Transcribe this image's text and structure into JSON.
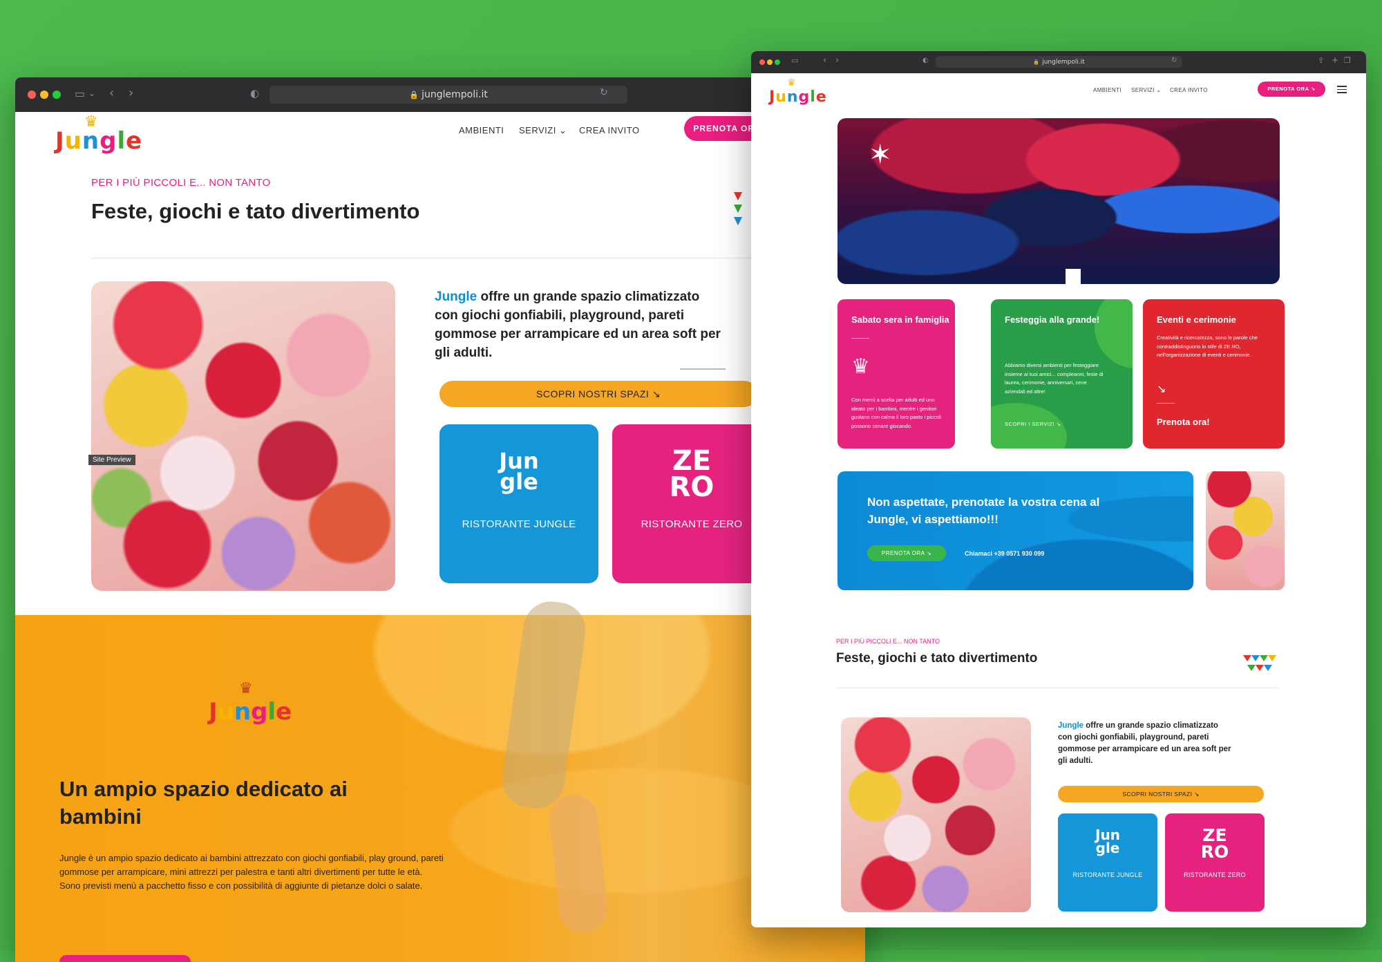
{
  "logo": {
    "letters": [
      "J",
      "u",
      "n",
      "g",
      "l",
      "e"
    ],
    "colors": [
      "#e63329",
      "#f4b400",
      "#1f8fd6",
      "#e91e7e",
      "#3aa935",
      "#e63329"
    ],
    "crown": "♛"
  },
  "left_window": {
    "url": "junglempoli.it",
    "nav": {
      "ambienti": "AMBIENTI",
      "servizi": "SERVIZI ⌄",
      "crea_invito": "CREA INVITO",
      "cta": "PRENOTA ORA ↘"
    },
    "kicker": "PER I PIÙ PICCOLI E... NON TANTO",
    "title": "Feste, giochi e tato divertimento",
    "site_preview": "Site Preview",
    "desc_brand": "Jungle",
    "desc_rest": " offre un grande spazio climatizzato con giochi gonfiabili, playground, pareti gommose per arrampicare ed un area soft per gli adulti.",
    "scopri": "SCOPRI NOSTRI SPAZI ↘",
    "tile_jungle": {
      "mark": "Jun\ngle",
      "label": "RISTORANTE JUNGLE"
    },
    "tile_zero": {
      "mark": "ZE\nRO",
      "label": "RISTORANTE ZERO"
    },
    "orange": {
      "title": "Un ampio spazio dedicato ai bambini",
      "text1": "Jungle è un ampio spazio dedicato ai bambini attrezzato con giochi gonfiabili, play ground, pareti gommose per arrampicare, mini attrezzi per palestra e tanti altri divertimenti per tutte le età.",
      "text2": "Sono previsti menù a pacchetto fisso e con possibilità di aggiunte di pietanze dolci o salate."
    }
  },
  "right_window": {
    "url": "junglempoli.it",
    "nav": {
      "ambienti": "AMBIENTI",
      "servizi": "SERVIZI ⌄",
      "crea_invito": "CREA INVITO",
      "cta": "PRENOTA ORA ↘"
    },
    "cards": [
      {
        "title": "Sabato sera in famiglia",
        "text": "Con menù a scelta per adulti ed uno ideato per i bambini, mentre i genitori gustano con calma il loro pasto i piccoli possono cenare giocando."
      },
      {
        "title": "Festeggia alla grande!",
        "text": "Abbiamo diversi ambienti per festeggiare insieme ai tuoi amici... compleanni, feste di laurea, cerimonie, anniversari, cene aziendali ed altre!",
        "button": "SCOPRI I SERVIZI ↘"
      },
      {
        "title": "Eventi e cerimonie",
        "text": "Creatività e ricercatezza, sono le parole che contraddistinguono lo stile di ZE.RO, nell'organizzazione di eventi e cerimonie.",
        "link": "Prenota ora!"
      }
    ],
    "banner": {
      "title": "Non aspettate, prenotate la vostra cena al Jungle, vi aspettiamo!!!",
      "button": "PRENOTA ORA ↘",
      "call": "Chiamaci +39 0571 930 099"
    },
    "kicker": "PER I PIÙ PICCOLI E... NON TANTO",
    "title": "Feste, giochi e tato divertimento",
    "desc_brand": "Jungle",
    "desc_rest": " offre un grande spazio climatizzato con giochi gonfiabili, playground, pareti gommose per arrampicare ed un area soft per gli adulti.",
    "scopri": "SCOPRI NOSTRI SPAZI ↘",
    "tile_jungle": {
      "mark": "Jun\ngle",
      "label": "RISTORANTE JUNGLE"
    },
    "tile_zero": {
      "mark": "ZE\nRO",
      "label": "RISTORANTE ZERO"
    }
  },
  "colors": {
    "background": "#4cb84d",
    "pink": "#e91e7e",
    "blue": "#1596d8",
    "orange": "#f5a623",
    "green": "#2a9d48",
    "red": "#e0262e"
  }
}
